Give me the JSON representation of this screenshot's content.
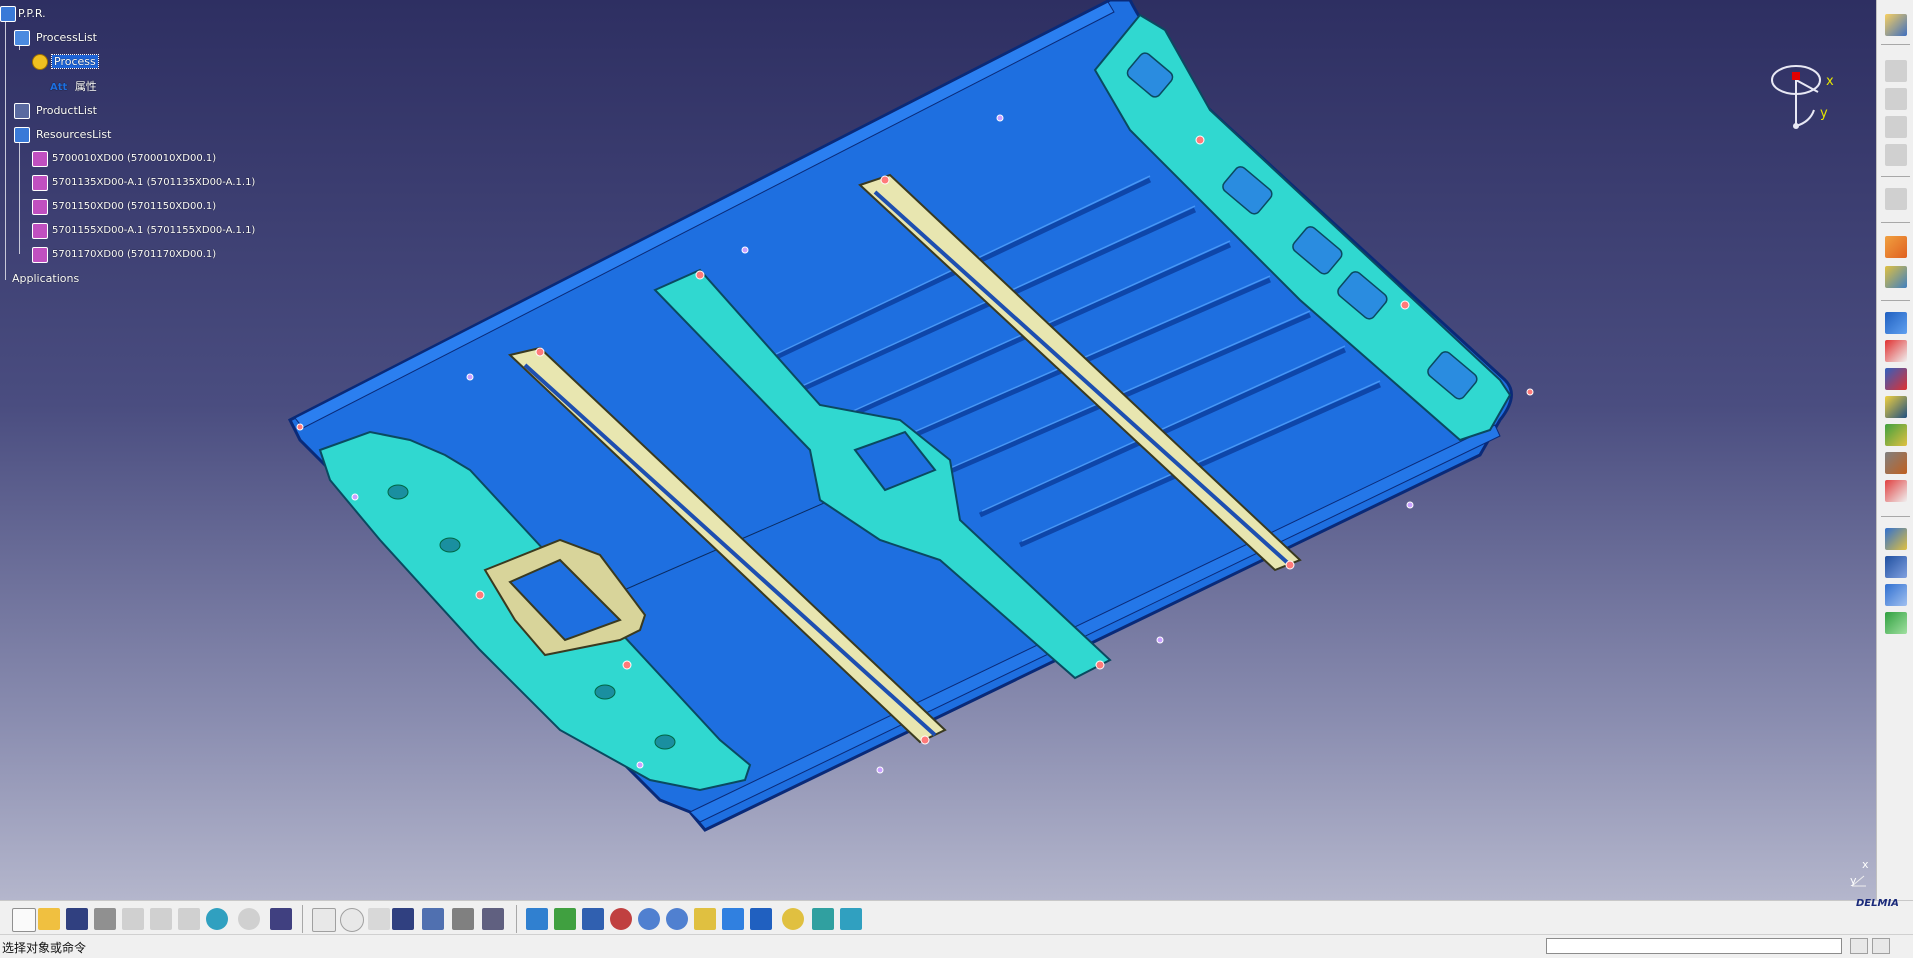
{
  "tree": {
    "root": "P.P.R.",
    "process_list": "ProcessList",
    "process": "Process",
    "attr_prefix": "Att",
    "attr": "属性",
    "product_list": "ProductList",
    "resources_list": "ResourcesList",
    "resources": [
      "5700010XD00 (5700010XD00.1)",
      "5701135XD00-A.1 (5701135XD00-A.1.1)",
      "5701150XD00 (5701150XD00.1)",
      "5701155XD00-A.1 (5701155XD00-A.1.1)",
      "5701170XD00 (5701170XD00.1)"
    ],
    "applications": "Applications"
  },
  "compass": {
    "x_label": "x",
    "y_label": "y"
  },
  "mini_axis": {
    "x_label": "x",
    "y_label": "y"
  },
  "status": {
    "prompt": "选择对象或命令",
    "command_value": ""
  },
  "brand": "DELMIA",
  "colors": {
    "viewport_top": "#2e2f62",
    "viewport_bottom": "#b4b6cc",
    "panel_blue": "#1e6fe0",
    "rail_cyan": "#28e0d4",
    "bracket_cream": "#e8e6b0",
    "selection": "#1d63d6"
  },
  "bottom_toolbar_icons": [
    "new-icon",
    "open-icon",
    "save-icon",
    "print-icon",
    "cut-icon",
    "copy-icon",
    "paste-icon",
    "undo-icon",
    "redo-icon",
    "whats-this-icon",
    "formula-icon",
    "comment-icon",
    "knowledge-icon",
    "table-icon",
    "tree-icon",
    "lock-icon",
    "catalog-icon",
    "fly-icon",
    "fit-all-icon",
    "pan-icon",
    "rotate-icon",
    "zoom-in-icon",
    "zoom-out-icon",
    "normal-view-icon",
    "multi-view-icon",
    "iso-view-icon",
    "shading-icon",
    "hide-show-icon",
    "swap-visible-icon"
  ],
  "right_toolbar_icons": [
    "workbench-icon",
    "tool-a-icon",
    "tool-b-icon",
    "tool-c-icon",
    "tool-d-icon",
    "tool-e-icon",
    "select-icon",
    "manipulate-icon",
    "process-icon",
    "xml-export-icon",
    "xml-import-icon",
    "report-icon",
    "resource-icon",
    "hammer-icon",
    "link-icon",
    "move-icon",
    "assembly-icon",
    "hierarchy-icon",
    "check-icon"
  ]
}
